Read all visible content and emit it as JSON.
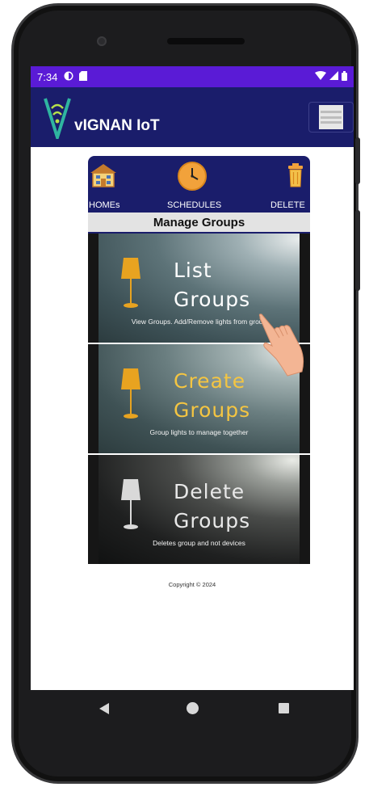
{
  "status_bar": {
    "time": "7:34"
  },
  "header": {
    "title": "vIGNAN IoT",
    "menu_icon": "hamburger-icon"
  },
  "nav": {
    "items": [
      {
        "label": "HOMEs",
        "icon": "house-icon"
      },
      {
        "label": "SCHEDULES",
        "icon": "clock-icon"
      },
      {
        "label": "DELETE",
        "icon": "trash-icon"
      }
    ]
  },
  "section": {
    "title": "Manage Groups"
  },
  "tiles": [
    {
      "title1": "List",
      "title2": "Groups",
      "subtitle": "View Groups. Add/Remove lights from group",
      "title_color": "#ffffff",
      "lamp_color": "#e8a320"
    },
    {
      "title1": "Create",
      "title2": "Groups",
      "subtitle": "Group lights to manage together",
      "title_color": "#f4c542",
      "lamp_color": "#e8a320"
    },
    {
      "title1": "Delete",
      "title2": "Groups",
      "subtitle": "Deletes group and not devices",
      "title_color": "#e8e8e8",
      "lamp_color": "#d9d9d9"
    }
  ],
  "footer": {
    "copyright": "Copyright © 2024"
  },
  "colors": {
    "status_bar": "#5a1bd6",
    "header": "#1a1d6b",
    "accent": "#f2a23b"
  }
}
